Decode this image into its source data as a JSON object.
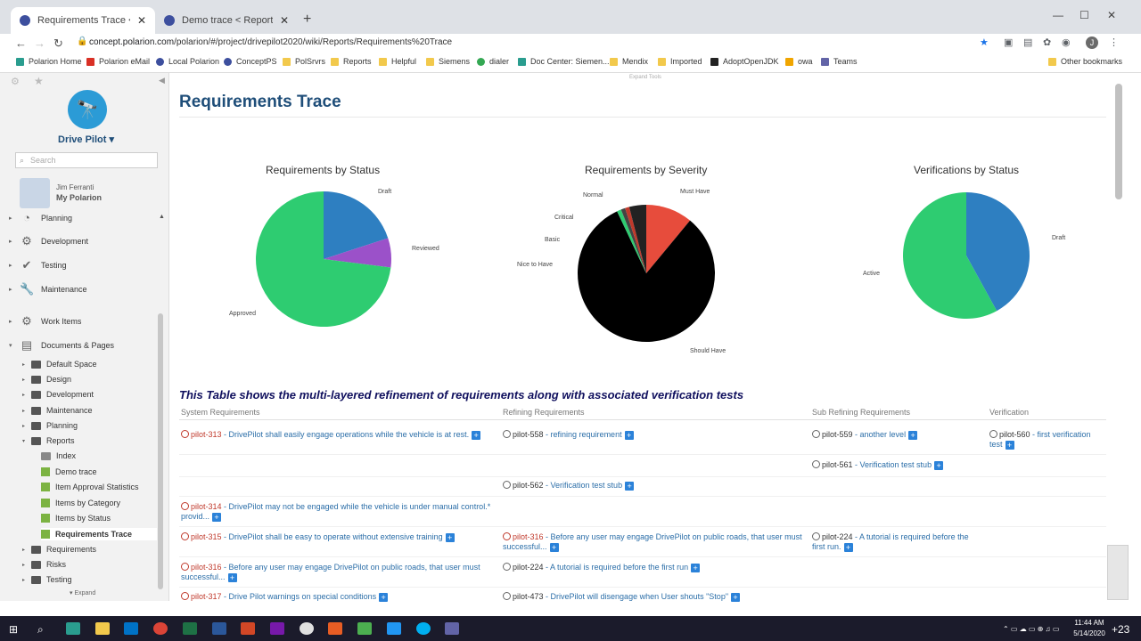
{
  "browser": {
    "tabs": [
      {
        "title": "Requirements Trace < Reports < ",
        "active": true
      },
      {
        "title": "Demo trace < Reports < Docum",
        "active": false
      }
    ],
    "url_host": "concept.polarion.com",
    "url_path": "/polarion/#/project/drivepilot2020/wiki/Reports/Requirements%20Trace",
    "bookmarks": [
      "Polarion Home",
      "Polarion eMail",
      "Local Polarion",
      "ConceptPS",
      "PolSrvrs",
      "Reports",
      "Helpful",
      "Siemens",
      "dialer",
      "Doc Center: Siemen...",
      "Mendix",
      "Imported",
      "AdoptOpenJDK",
      "owa",
      "Teams"
    ],
    "other_bookmarks": "Other bookmarks"
  },
  "sidebar": {
    "project": "Drive Pilot",
    "search_placeholder": "Search",
    "user_name": "Jim Ferranti",
    "user_link": "My Polarion",
    "nav": [
      "Planning",
      "Development",
      "Testing",
      "Maintenance",
      "Work Items",
      "Documents & Pages"
    ],
    "tree": [
      "Default Space",
      "Design",
      "Development",
      "Maintenance",
      "Planning",
      "Reports",
      "Index",
      "Demo trace",
      "Item Approval Statistics",
      "Items by Category",
      "Items by Status",
      "Requirements Trace",
      "Requirements",
      "Risks",
      "Testing"
    ],
    "expand": "Expand"
  },
  "main": {
    "expand_tools": "Expand Tools",
    "title": "Requirements Trace",
    "charts": [
      {
        "title": "Requirements by Status",
        "labels": [
          "Draft",
          "Reviewed",
          "Approved"
        ]
      },
      {
        "title": "Requirements by Severity",
        "labels": [
          "Must Have",
          "Normal",
          "Critical",
          "Basic",
          "Nice to Have",
          "Should Have"
        ]
      },
      {
        "title": "Verifications by Status",
        "labels": [
          "Draft",
          "Active"
        ]
      }
    ],
    "table_heading": "This Table shows the multi-layered refinement of requirements along with associated verification tests",
    "columns": [
      "System Requirements",
      "Refining Requirements",
      "Sub Refining Requirements",
      "Verification"
    ]
  },
  "chart_data": [
    {
      "type": "pie",
      "title": "Requirements by Status",
      "categories": [
        "Draft",
        "Reviewed",
        "Approved"
      ],
      "values": [
        20,
        7,
        73
      ],
      "colors": [
        "#2e7fc1",
        "#9b51c9",
        "#2ecc71"
      ]
    },
    {
      "type": "pie",
      "title": "Requirements by Severity",
      "categories": [
        "Must Have",
        "Should Have",
        "Nice to Have",
        "Basic",
        "Critical",
        "Normal"
      ],
      "values": [
        11,
        82,
        1,
        1,
        1,
        4
      ],
      "colors": [
        "#e74c3c",
        "#000000",
        "#2ecc71",
        "#444444",
        "#c0392b",
        "#222222"
      ]
    },
    {
      "type": "pie",
      "title": "Verifications by Status",
      "categories": [
        "Draft",
        "Active"
      ],
      "values": [
        42,
        58
      ],
      "colors": [
        "#2e7fc1",
        "#2ecc71"
      ]
    }
  ],
  "rows": {
    "r1c1_id": "pilot-313",
    "r1c1_text": " - DrivePilot shall easily engage operations while the vehicle is at rest.",
    "r1c2_id": "pilot-558",
    "r1c2_text": " - refining requirement",
    "r1c3_id": "pilot-559",
    "r1c3_text": " - another level",
    "r1c4_id": "pilot-560",
    "r1c4_text": " - first verification test",
    "r2c3_id": "pilot-561",
    "r2c3_text": " - Verification test stub",
    "r3c2_id": "pilot-562",
    "r3c2_text": " - Verification test stub",
    "r4c1_id": "pilot-314",
    "r4c1_text": " - DrivePilot may not be engaged while the vehicle is under manual control.* provid...",
    "r5c1_id": "pilot-315",
    "r5c1_text": " - DrivePilot shall be easy to operate without extensive training",
    "r5c2_id": "pilot-316",
    "r5c2_text": " - Before any user may engage DrivePilot on public roads, that user must successful...",
    "r5c3_id": "pilot-224",
    "r5c3_text": " - A tutorial is required before the first run.",
    "r6c1_id": "pilot-316",
    "r6c1_text": " - Before any user may engage DrivePilot on public roads, that user must successful...",
    "r6c2_id": "pilot-224",
    "r6c2_text": " - A tutorial is required before the first run",
    "r7c1_id": "pilot-317",
    "r7c1_text": " - Drive Pilot warnings on special conditions",
    "r7c2_id": "pilot-473",
    "r7c2_text": " - DrivePilot will disengage when User shouts \"Stop\""
  },
  "taskbar": {
    "time": "11:44 AM",
    "date": "5/14/2020",
    "badge": "+23"
  }
}
